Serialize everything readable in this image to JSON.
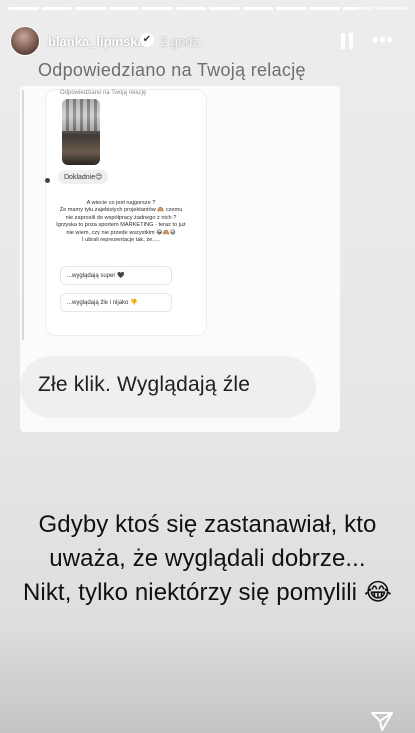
{
  "story": {
    "progress": [
      1,
      1,
      1,
      1,
      1,
      1,
      1,
      1,
      1,
      1,
      0.5,
      0
    ],
    "user": {
      "username": "blanka_lipinska",
      "verified_mark": "✔",
      "time": "2 godz."
    },
    "reply_label": "Odpowiedziano na Twoją relację",
    "embedded": {
      "header": "Odpowiedziano na Twoją relację",
      "bubble": "Dokladnie😊",
      "text_lines": [
        "A wiecie co jest najgorsze ?",
        "Że mamy tylu zajebistych projektantów 🙈 czemu",
        "nie zaprosili do współpracy żadnego z nich ?",
        "Igrzyska to poza sportem MARKETING - teraz to już",
        "nie wiem, czy nie przede wszystkim 😂🙈😅",
        "I ubrali reprezentacje tak, że....."
      ],
      "option1": "...wyglądają super 🖤",
      "option2": "...wyglądają źle i nijako 👎"
    },
    "reply_text": "Złe klik. Wyglądają źle",
    "caption": [
      "Gdyby ktoś się zastanawiał, kto",
      "uważa, że wyglądali dobrze...",
      "Nikt, tylko niektórzy się pomylili 😂"
    ],
    "icons": {
      "pause": "pause-icon",
      "more": "more-icon",
      "send": "send-icon",
      "verified": "verified-badge-icon"
    },
    "colors": {
      "accent": "#ffffff",
      "caption": "#111111",
      "label": "#6e6e6e"
    }
  }
}
